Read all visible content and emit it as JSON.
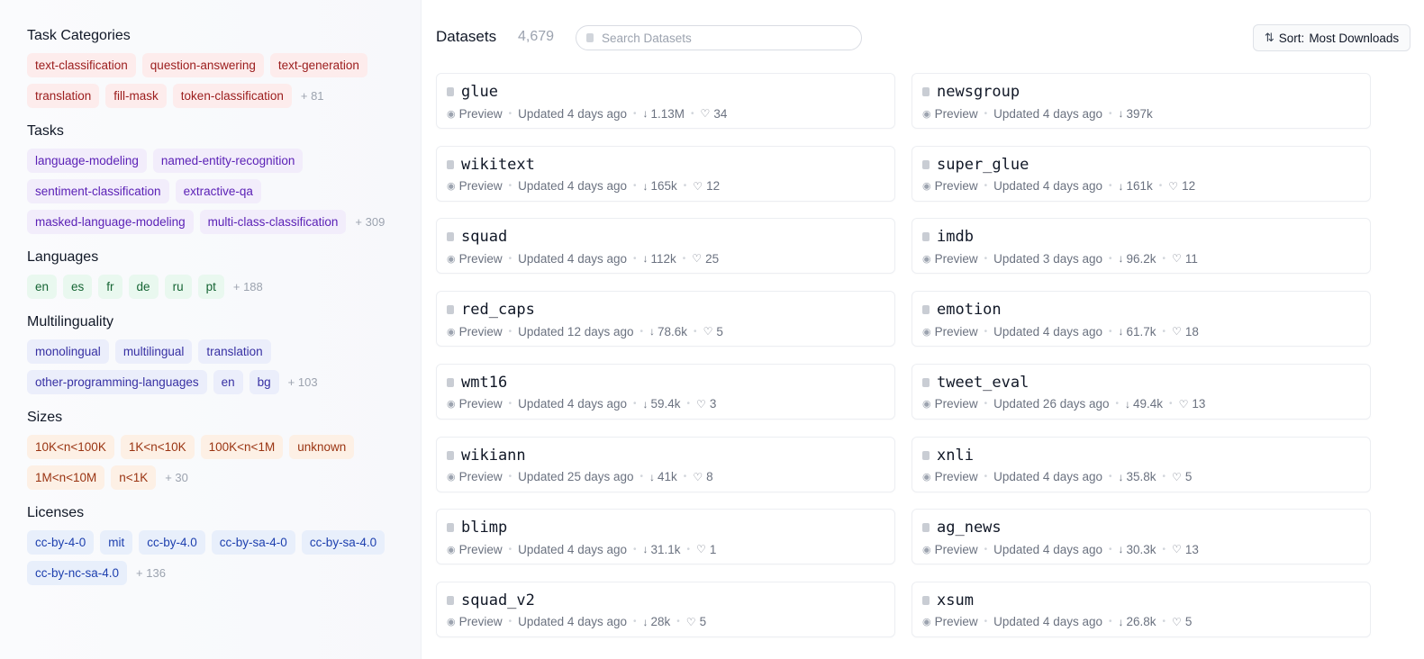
{
  "sidebar": {
    "sections": [
      {
        "title": "Task Categories",
        "color": "red",
        "rows": [
          [
            "text-classification",
            "question-answering",
            "text-generation"
          ],
          [
            "translation",
            "fill-mask",
            "token-classification"
          ]
        ],
        "more": "+ 81"
      },
      {
        "title": "Tasks",
        "color": "purple",
        "rows": [
          [
            "language-modeling",
            "named-entity-recognition"
          ],
          [
            "sentiment-classification",
            "extractive-qa"
          ],
          [
            "masked-language-modeling",
            "multi-class-classification"
          ]
        ],
        "more": "+ 309"
      },
      {
        "title": "Languages",
        "color": "green",
        "rows": [
          [
            "en",
            "es",
            "fr",
            "de",
            "ru",
            "pt"
          ]
        ],
        "more": "+ 188"
      },
      {
        "title": "Multilinguality",
        "color": "indigo",
        "rows": [
          [
            "monolingual",
            "multilingual",
            "translation"
          ],
          [
            "other-programming-languages",
            "en",
            "bg"
          ]
        ],
        "more": "+ 103"
      },
      {
        "title": "Sizes",
        "color": "orange",
        "rows": [
          [
            "10K<n<100K",
            "1K<n<10K",
            "100K<n<1M",
            "unknown"
          ],
          [
            "1M<n<10M",
            "n<1K"
          ]
        ],
        "more": "+ 30"
      },
      {
        "title": "Licenses",
        "color": "blue",
        "rows": [
          [
            "cc-by-4-0",
            "mit",
            "cc-by-4.0",
            "cc-by-sa-4-0",
            "cc-by-sa-4.0"
          ],
          [
            "cc-by-nc-sa-4.0"
          ]
        ],
        "more": "+ 136"
      }
    ]
  },
  "header": {
    "title": "Datasets",
    "count": "4,679",
    "search_placeholder": "Search Datasets",
    "sort_label": "Sort:",
    "sort_value": "Most Downloads"
  },
  "datasets": [
    {
      "name": "glue",
      "preview": "Preview",
      "updated": "Updated 4 days ago",
      "downloads": "1.13M",
      "likes": "34"
    },
    {
      "name": "newsgroup",
      "preview": "Preview",
      "updated": "Updated 4 days ago",
      "downloads": "397k",
      "likes": ""
    },
    {
      "name": "wikitext",
      "preview": "Preview",
      "updated": "Updated 4 days ago",
      "downloads": "165k",
      "likes": "12"
    },
    {
      "name": "super_glue",
      "preview": "Preview",
      "updated": "Updated 4 days ago",
      "downloads": "161k",
      "likes": "12"
    },
    {
      "name": "squad",
      "preview": "Preview",
      "updated": "Updated 4 days ago",
      "downloads": "112k",
      "likes": "25"
    },
    {
      "name": "imdb",
      "preview": "Preview",
      "updated": "Updated 3 days ago",
      "downloads": "96.2k",
      "likes": "11"
    },
    {
      "name": "red_caps",
      "preview": "Preview",
      "updated": "Updated 12 days ago",
      "downloads": "78.6k",
      "likes": "5"
    },
    {
      "name": "emotion",
      "preview": "Preview",
      "updated": "Updated 4 days ago",
      "downloads": "61.7k",
      "likes": "18"
    },
    {
      "name": "wmt16",
      "preview": "Preview",
      "updated": "Updated 4 days ago",
      "downloads": "59.4k",
      "likes": "3"
    },
    {
      "name": "tweet_eval",
      "preview": "Preview",
      "updated": "Updated 26 days ago",
      "downloads": "49.4k",
      "likes": "13"
    },
    {
      "name": "wikiann",
      "preview": "Preview",
      "updated": "Updated 25 days ago",
      "downloads": "41k",
      "likes": "8"
    },
    {
      "name": "xnli",
      "preview": "Preview",
      "updated": "Updated 4 days ago",
      "downloads": "35.8k",
      "likes": "5"
    },
    {
      "name": "blimp",
      "preview": "Preview",
      "updated": "Updated 4 days ago",
      "downloads": "31.1k",
      "likes": "1"
    },
    {
      "name": "ag_news",
      "preview": "Preview",
      "updated": "Updated 4 days ago",
      "downloads": "30.3k",
      "likes": "13"
    },
    {
      "name": "squad_v2",
      "preview": "Preview",
      "updated": "Updated 4 days ago",
      "downloads": "28k",
      "likes": "5"
    },
    {
      "name": "xsum",
      "preview": "Preview",
      "updated": "Updated 4 days ago",
      "downloads": "26.8k",
      "likes": "5"
    }
  ],
  "icons": {
    "search": "search-icon",
    "sort": "sort-icon",
    "dataset": "database-icon",
    "preview": "eye-icon",
    "downloads": "download-arrow-icon",
    "likes": "heart-icon"
  }
}
